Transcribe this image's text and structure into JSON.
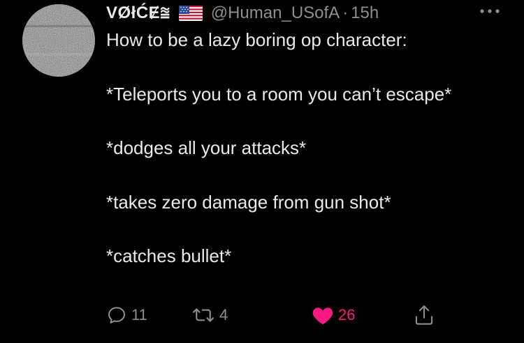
{
  "author": {
    "display_name": "VØłĆɆ⩰",
    "flag_icon": "us-flag-icon",
    "handle": "@Human_USofA",
    "separator": "·",
    "time": "15h"
  },
  "tweet": {
    "text": "How to be a lazy boring op character:\n\n*Teleports you to a room you can’t escape*\n\n*dodges all your attacks*\n\n*takes zero damage from gun shot*\n\n*catches bullet*"
  },
  "actions": {
    "reply_icon": "reply-bubble-icon",
    "reply_count": "11",
    "retweet_icon": "retweet-icon",
    "retweet_count": "4",
    "like_icon": "heart-filled-icon",
    "like_count": "26",
    "share_icon": "share-icon"
  },
  "colors": {
    "background": "#000000",
    "text_primary": "#e7e9ea",
    "text_secondary": "#8b8f94",
    "like_active": "#f91880"
  }
}
